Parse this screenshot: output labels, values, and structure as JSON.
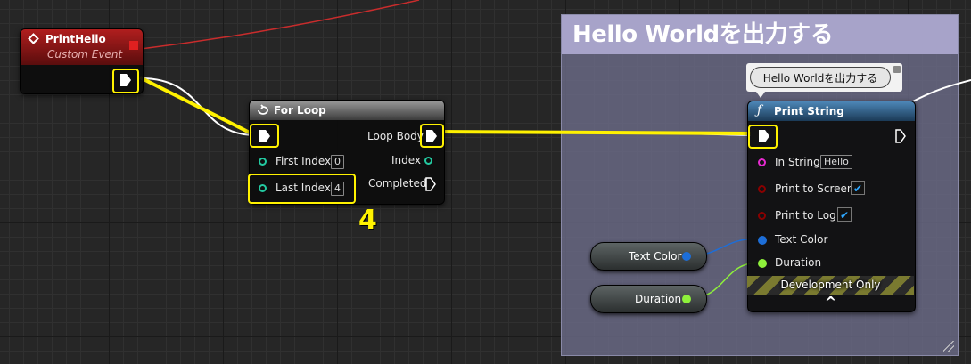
{
  "comment": {
    "title": "Hello Worldを出力する"
  },
  "event_node": {
    "title": "PrintHello",
    "subtitle": "Custom Event"
  },
  "for_loop": {
    "title": "For Loop",
    "first_index_label": "First Index",
    "first_index_value": "0",
    "last_index_label": "Last Index",
    "last_index_value": "4",
    "loop_body_label": "Loop Body",
    "index_label": "Index",
    "completed_label": "Completed"
  },
  "print_string": {
    "bubble": "Hello Worldを出力する",
    "title": "Print String",
    "in_string_label": "In String",
    "in_string_value": "Hello",
    "print_to_screen_label": "Print to Screen",
    "print_to_log_label": "Print to Log",
    "text_color_label": "Text Color",
    "duration_label": "Duration",
    "dev_only_label": "Development Only",
    "check_glyph": "✔",
    "expand_glyph": "^"
  },
  "variables": {
    "text_color": "Text Color",
    "duration": "Duration"
  },
  "annotation": "4",
  "colors": {
    "event_header": "#8b1a1a",
    "function_header": "#3a6e9a",
    "exec_highlight": "#fff200",
    "string_pin": "#e62ad0",
    "bool_pin": "#8a0000",
    "struct_pin": "#1d6ed8",
    "float_pin": "#8ef03b",
    "int_pin": "#23c9a0"
  }
}
